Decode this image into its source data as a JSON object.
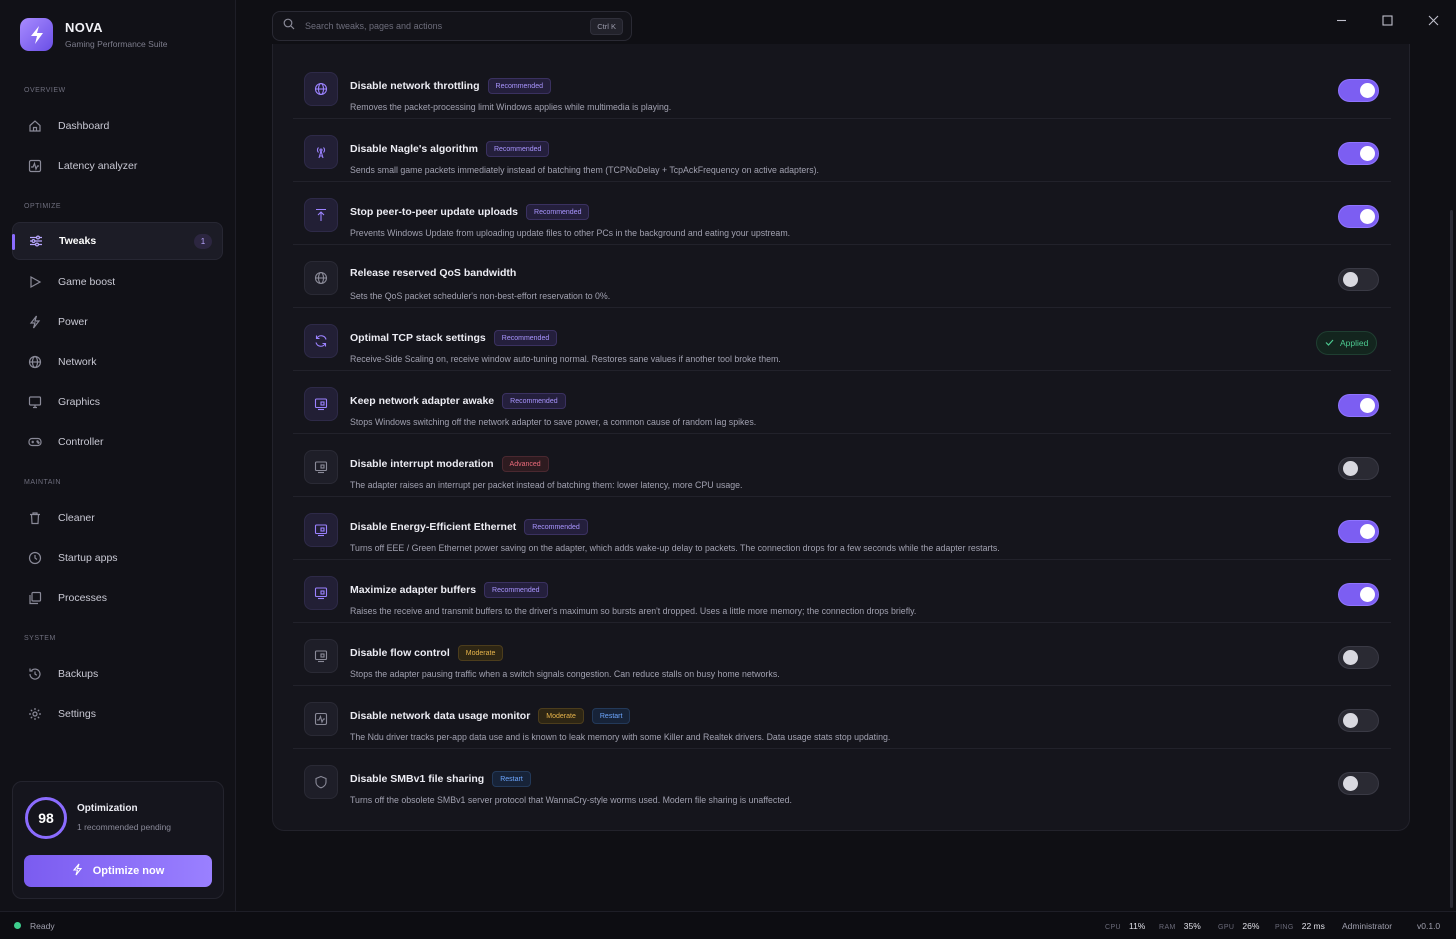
{
  "brand": {
    "name": "NOVA",
    "subtitle": "Gaming Performance Suite"
  },
  "sidebar": {
    "sections": {
      "overview": "OVERVIEW",
      "optimize": "OPTIMIZE",
      "maintain": "MAINTAIN",
      "system": "SYSTEM"
    },
    "items": [
      {
        "label": "Dashboard",
        "icon": "home-icon"
      },
      {
        "label": "Latency analyzer",
        "icon": "pulse-icon"
      },
      {
        "label": "Tweaks",
        "icon": "sliders-icon",
        "badge": "1",
        "active": true
      },
      {
        "label": "Game boost",
        "icon": "play-icon"
      },
      {
        "label": "Power",
        "icon": "bolt-icon"
      },
      {
        "label": "Network",
        "icon": "globe-icon"
      },
      {
        "label": "Graphics",
        "icon": "monitor-icon"
      },
      {
        "label": "Controller",
        "icon": "gamepad-icon"
      },
      {
        "label": "Cleaner",
        "icon": "trash-icon"
      },
      {
        "label": "Startup apps",
        "icon": "clock-icon"
      },
      {
        "label": "Processes",
        "icon": "copy-icon"
      },
      {
        "label": "Backups",
        "icon": "history-icon"
      },
      {
        "label": "Settings",
        "icon": "gear-icon"
      }
    ]
  },
  "optimization": {
    "score": "98",
    "title": "Optimization",
    "subtitle": "1 recommended pending",
    "button": "Optimize now"
  },
  "search": {
    "placeholder": "Search tweaks, pages and actions",
    "shortcut": "Ctrl K"
  },
  "tweaks": [
    {
      "title": "Disable network throttling",
      "tags": [
        {
          "label": "Recommended",
          "kind": "rec"
        }
      ],
      "desc": "Removes the packet-processing limit Windows applies while multimedia is playing.",
      "state": "on",
      "icon": "globe-icon"
    },
    {
      "title": "Disable Nagle's algorithm",
      "tags": [
        {
          "label": "Recommended",
          "kind": "rec"
        }
      ],
      "desc": "Sends small game packets immediately instead of batching them (TCPNoDelay + TcpAckFrequency on active adapters).",
      "state": "on",
      "icon": "antenna-icon"
    },
    {
      "title": "Stop peer-to-peer update uploads",
      "tags": [
        {
          "label": "Recommended",
          "kind": "rec"
        }
      ],
      "desc": "Prevents Windows Update from uploading update files to other PCs in the background and eating your upstream.",
      "state": "on",
      "icon": "upload-icon"
    },
    {
      "title": "Release reserved QoS bandwidth",
      "tags": [],
      "desc": "Sets the QoS packet scheduler's non-best-effort reservation to 0%.",
      "state": "off",
      "icon": "globe-icon"
    },
    {
      "title": "Optimal TCP stack settings",
      "tags": [
        {
          "label": "Recommended",
          "kind": "rec"
        }
      ],
      "desc": "Receive-Side Scaling on, receive window auto-tuning normal. Restores sane values if another tool broke them.",
      "state": "applied",
      "applied_label": "Applied",
      "icon": "refresh-icon"
    },
    {
      "title": "Keep network adapter awake",
      "tags": [
        {
          "label": "Recommended",
          "kind": "rec"
        }
      ],
      "desc": "Stops Windows switching off the network adapter to save power, a common cause of random lag spikes.",
      "state": "on",
      "icon": "adapter-icon"
    },
    {
      "title": "Disable interrupt moderation",
      "tags": [
        {
          "label": "Advanced",
          "kind": "adv"
        }
      ],
      "desc": "The adapter raises an interrupt per packet instead of batching them: lower latency, more CPU usage.",
      "state": "off",
      "icon": "adapter-icon"
    },
    {
      "title": "Disable Energy-Efficient Ethernet",
      "tags": [
        {
          "label": "Recommended",
          "kind": "rec"
        }
      ],
      "desc": "Turns off EEE / Green Ethernet power saving on the adapter, which adds wake-up delay to packets. The connection drops for a few seconds while the adapter restarts.",
      "state": "on",
      "icon": "adapter-icon"
    },
    {
      "title": "Maximize adapter buffers",
      "tags": [
        {
          "label": "Recommended",
          "kind": "rec"
        }
      ],
      "desc": "Raises the receive and transmit buffers to the driver's maximum so bursts aren't dropped. Uses a little more memory; the connection drops briefly.",
      "state": "on",
      "icon": "adapter-icon"
    },
    {
      "title": "Disable flow control",
      "tags": [
        {
          "label": "Moderate",
          "kind": "mod"
        }
      ],
      "desc": "Stops the adapter pausing traffic when a switch signals congestion. Can reduce stalls on busy home networks.",
      "state": "off",
      "icon": "adapter-icon"
    },
    {
      "title": "Disable network data usage monitor",
      "tags": [
        {
          "label": "Moderate",
          "kind": "mod"
        },
        {
          "label": "Restart",
          "kind": "rst"
        }
      ],
      "desc": "The Ndu driver tracks per-app data use and is known to leak memory with some Killer and Realtek drivers. Data usage stats stop updating.",
      "state": "off",
      "icon": "chart-icon"
    },
    {
      "title": "Disable SMBv1 file sharing",
      "tags": [
        {
          "label": "Restart",
          "kind": "rst"
        }
      ],
      "desc": "Turns off the obsolete SMBv1 server protocol that WannaCry-style worms used. Modern file sharing is unaffected.",
      "state": "off",
      "icon": "shield-icon"
    }
  ],
  "statusbar": {
    "status": "Ready",
    "cpu_label": "CPU",
    "cpu": "11%",
    "ram_label": "RAM",
    "ram": "35%",
    "gpu_label": "GPU",
    "gpu": "26%",
    "ping_label": "PING",
    "ping": "22 ms",
    "user": "Administrator",
    "version": "v0.1.0"
  },
  "colors": {
    "accent": "#7c5ef2",
    "success": "#3ecf8e",
    "background": "#0f0f14"
  }
}
